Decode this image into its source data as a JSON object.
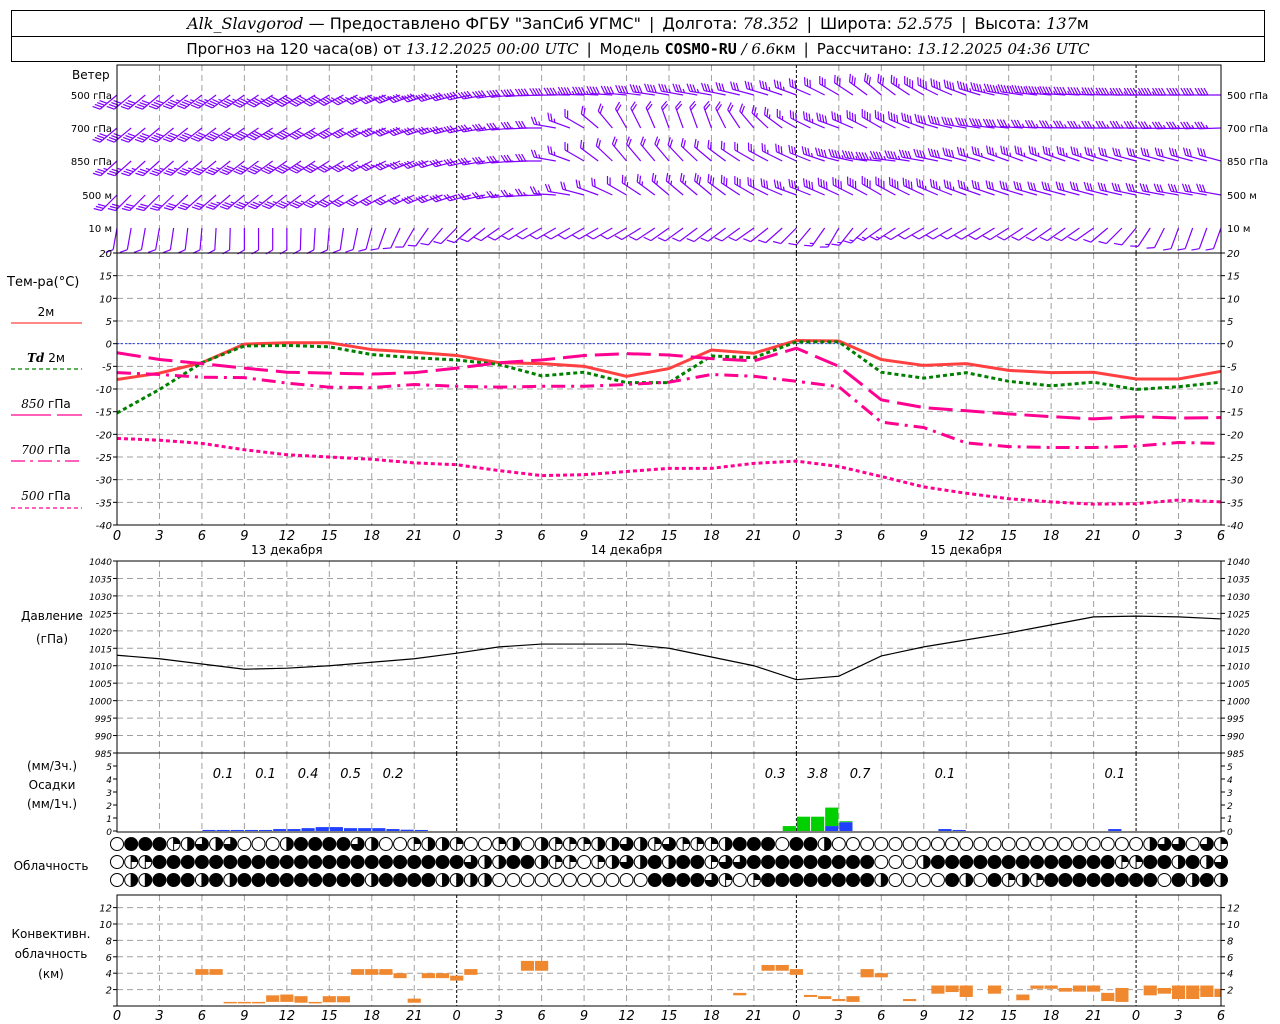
{
  "header": {
    "station": "Alk_Slavgorod",
    "provider": " — Предоставлено ФГБУ \"ЗапСиб УГМС\"",
    "lon_label": "Долгота: ",
    "lon": "78.352",
    "lat_label": "Широта: ",
    "lat": "52.575",
    "alt_label": "Высота: ",
    "alt": "137",
    "alt_unit": "м",
    "forecast_label": "Прогноз на 120 часа(ов) от ",
    "forecast_time": "13.12.2025 00:00 UTC",
    "model_label": "Модель ",
    "model": "COSMO-RU",
    "model_res": " / 6.6",
    "model_res_unit": "км",
    "calc_label": "Рассчитано: ",
    "calc_time": "13.12.2025 04:36 UTC"
  },
  "labels": {
    "wind": "Ветер",
    "temp": "Тем-ра(°C)",
    "t2m": "2м",
    "td_a": "Td",
    "td_b": " 2м",
    "p850_a": "850",
    "p850_b": " гПа",
    "p700_a": "700",
    "p700_b": " гПа",
    "p500_a": "500",
    "p500_b": " гПа",
    "pressure_a": "Давление",
    "pressure_b": "(гПа)",
    "precip_a": "(мм/3ч.)",
    "precip_b": "Осадки",
    "precip_c": "(мм/1ч.)",
    "cloud": "Облачность",
    "conv_a": "Конвективн.",
    "conv_b": "облачность",
    "conv_c": "(км)"
  },
  "colors": {
    "wind": "#8000ff",
    "t2m": "#ff4040",
    "td": "#008000",
    "upper": "#ff0090",
    "zero_line": "#2040ff",
    "precip_rain": "#2040ff",
    "precip_snow": "#00d000",
    "convective": "#f08830",
    "grid": "#a0a0a0"
  },
  "chart_data": {
    "type": "meteogram",
    "time_axis": {
      "hours_range": [
        0,
        78
      ],
      "tick_labels": [
        "0",
        "3",
        "6",
        "9",
        "12",
        "15",
        "18",
        "21",
        "0",
        "3",
        "6",
        "9",
        "12",
        "15",
        "18",
        "21",
        "0",
        "3",
        "6",
        "9",
        "12",
        "15",
        "18",
        "21",
        "0",
        "3",
        "6"
      ],
      "day_labels": [
        {
          "hour": 12,
          "text": "13 декабря"
        },
        {
          "hour": 36,
          "text": "14 декабря"
        },
        {
          "hour": 60,
          "text": "15 декабря"
        }
      ],
      "day_boundaries": [
        0,
        24,
        48,
        72
      ]
    },
    "wind": {
      "levels": [
        {
          "name": "500 гПа",
          "dir": [
            230,
            230,
            232,
            235,
            238,
            240,
            245,
            250,
            255,
            262,
            268,
            272,
            275,
            280,
            280,
            285,
            290,
            300,
            310,
            300,
            290,
            280,
            275,
            272,
            270,
            270,
            270
          ],
          "speed": [
            22,
            22,
            23,
            24,
            25,
            25,
            24,
            23,
            22,
            22,
            22,
            23,
            22,
            20,
            18,
            17,
            18,
            15,
            16,
            20,
            22,
            25,
            25,
            24,
            24,
            22,
            22
          ]
        },
        {
          "name": "700 гПа",
          "dir": [
            230,
            230,
            232,
            235,
            238,
            240,
            245,
            250,
            255,
            262,
            270,
            300,
            330,
            340,
            340,
            320,
            300,
            290,
            300,
            290,
            280,
            275,
            272,
            270,
            270,
            268,
            268
          ],
          "speed": [
            20,
            20,
            21,
            22,
            22,
            22,
            21,
            20,
            19,
            18,
            16,
            12,
            10,
            10,
            11,
            12,
            14,
            20,
            22,
            22,
            20,
            20,
            19,
            19,
            18,
            18,
            18
          ]
        },
        {
          "name": "850 гПа",
          "dir": [
            228,
            228,
            230,
            232,
            235,
            238,
            242,
            248,
            255,
            262,
            270,
            300,
            320,
            320,
            310,
            300,
            295,
            285,
            275,
            280,
            285,
            290,
            290,
            288,
            285,
            285,
            285
          ],
          "speed": [
            18,
            18,
            19,
            20,
            20,
            20,
            19,
            18,
            17,
            16,
            15,
            12,
            10,
            10,
            11,
            12,
            15,
            22,
            24,
            22,
            20,
            18,
            18,
            18,
            17,
            17,
            17
          ]
        },
        {
          "name": "500 м",
          "dir": [
            225,
            225,
            228,
            230,
            232,
            235,
            240,
            245,
            252,
            260,
            268,
            285,
            300,
            310,
            310,
            300,
            290,
            295,
            300,
            295,
            290,
            288,
            285,
            285,
            282,
            280,
            280
          ],
          "speed": [
            16,
            16,
            17,
            18,
            18,
            18,
            17,
            16,
            15,
            14,
            13,
            12,
            12,
            14,
            15,
            16,
            18,
            22,
            22,
            20,
            18,
            17,
            17,
            16,
            16,
            15,
            15
          ]
        },
        {
          "name": "10  м",
          "dir": [
            190,
            190,
            185,
            180,
            180,
            185,
            195,
            210,
            225,
            235,
            240,
            240,
            240,
            235,
            232,
            235,
            225,
            210,
            235,
            240,
            240,
            238,
            235,
            235,
            220,
            200,
            200
          ],
          "speed": [
            6,
            6,
            7,
            7,
            7,
            7,
            7,
            7,
            7,
            7,
            7,
            7,
            7,
            7,
            6,
            6,
            7,
            8,
            8,
            7,
            7,
            7,
            7,
            6,
            6,
            6,
            6
          ]
        }
      ]
    },
    "temperature": {
      "ylim": [
        -40,
        20
      ],
      "ticks": [
        "20",
        "15",
        "10",
        "5",
        "0",
        "-5",
        "-10",
        "-15",
        "-20",
        "-25",
        "-30",
        "-35",
        "-40"
      ],
      "series": [
        {
          "name": "2м",
          "values": [
            -7.9,
            -6.5,
            -4.2,
            -0.1,
            0.2,
            0.2,
            -1.3,
            -1.9,
            -2.6,
            -4.2,
            -4.4,
            -5.0,
            -7.2,
            -5.5,
            -1.4,
            -2.1,
            0.7,
            0.6,
            -3.5,
            -4.8,
            -4.4,
            -5.9,
            -6.4,
            -6.3,
            -7.8,
            -7.8,
            -6.1
          ]
        },
        {
          "name": "Td 2м",
          "values": [
            -15.3,
            -10.1,
            -4.2,
            -0.5,
            -0.4,
            -0.7,
            -2.4,
            -3.1,
            -3.6,
            -4.6,
            -7.1,
            -6.3,
            -8.6,
            -8.6,
            -2.7,
            -3.1,
            0.4,
            0.4,
            -6.3,
            -7.6,
            -6.4,
            -8.3,
            -9.3,
            -8.5,
            -10.1,
            -9.5,
            -8.5
          ]
        },
        {
          "name": "850 гПа",
          "values": [
            -2.0,
            -3.5,
            -4.4,
            -5.4,
            -6.3,
            -6.5,
            -6.7,
            -6.4,
            -5.4,
            -4.2,
            -3.6,
            -2.6,
            -2.2,
            -2.5,
            -3.3,
            -3.8,
            -1.0,
            -5.0,
            -12.4,
            -14.1,
            -14.8,
            -15.5,
            -16.1,
            -16.6,
            -16.1,
            -16.4,
            -16.3
          ]
        },
        {
          "name": "700 гПа",
          "values": [
            -6.4,
            -6.8,
            -7.4,
            -7.5,
            -8.7,
            -9.6,
            -9.7,
            -9.0,
            -9.4,
            -9.6,
            -9.4,
            -9.4,
            -9.0,
            -8.5,
            -6.8,
            -7.2,
            -8.3,
            -9.5,
            -17.3,
            -18.5,
            -21.9,
            -22.7,
            -22.9,
            -22.9,
            -22.6,
            -21.8,
            -22.0
          ]
        },
        {
          "name": "500 гПа",
          "values": [
            -20.9,
            -21.3,
            -22.0,
            -23.4,
            -24.5,
            -25.0,
            -25.5,
            -26.3,
            -26.7,
            -28.0,
            -29.1,
            -28.9,
            -28.2,
            -27.5,
            -27.5,
            -26.4,
            -25.9,
            -27.1,
            -29.3,
            -31.6,
            -33.0,
            -34.2,
            -34.9,
            -35.4,
            -35.3,
            -34.5,
            -34.9
          ]
        }
      ]
    },
    "pressure": {
      "ylim": [
        985,
        1040
      ],
      "ticks": [
        "1040",
        "1035",
        "1030",
        "1025",
        "1020",
        "1015",
        "1010",
        "1005",
        "1000",
        "995",
        "990",
        "985"
      ],
      "values": [
        1013,
        1012,
        1010.5,
        1009,
        1009.3,
        1010,
        1011,
        1012,
        1013.6,
        1015.4,
        1016.2,
        1016.2,
        1016.2,
        1015,
        1012.5,
        1010,
        1006,
        1007,
        1012.8,
        1015.4,
        1017.4,
        1019.4,
        1021.7,
        1024,
        1024.2,
        1024,
        1023.4
      ]
    },
    "precipitation": {
      "ylim": [
        0,
        5
      ],
      "ticks": [
        "5",
        "4",
        "3",
        "2",
        "1",
        "0"
      ],
      "hourly_rain": [
        [
          6,
          0.08
        ],
        [
          7,
          0.08
        ],
        [
          8,
          0.08
        ],
        [
          9,
          0.08
        ],
        [
          10,
          0.08
        ],
        [
          11,
          0.15
        ],
        [
          12,
          0.15
        ],
        [
          13,
          0.22
        ],
        [
          14,
          0.3
        ],
        [
          15,
          0.3
        ],
        [
          16,
          0.22
        ],
        [
          17,
          0.22
        ],
        [
          18,
          0.22
        ],
        [
          19,
          0.15
        ],
        [
          20,
          0.1
        ],
        [
          21,
          0.08
        ],
        [
          50,
          0.38
        ],
        [
          51,
          0.68
        ],
        [
          58,
          0.15
        ],
        [
          59,
          0.08
        ],
        [
          70,
          0.15
        ]
      ],
      "hourly_snow": [
        [
          47,
          0.38
        ],
        [
          48,
          1.1
        ],
        [
          49,
          1.1
        ],
        [
          50,
          1.42
        ],
        [
          51,
          0.07
        ]
      ],
      "totals_3h": [
        {
          "hour": 7.5,
          "text": "0.1"
        },
        {
          "hour": 10.5,
          "text": "0.1"
        },
        {
          "hour": 13.5,
          "text": "0.4"
        },
        {
          "hour": 16.5,
          "text": "0.5"
        },
        {
          "hour": 19.5,
          "text": "0.2"
        },
        {
          "hour": 46.5,
          "text": "0.3"
        },
        {
          "hour": 49.5,
          "text": "3.8"
        },
        {
          "hour": 52.5,
          "text": "0.7"
        },
        {
          "hour": 58.5,
          "text": "0.1"
        },
        {
          "hour": 70.5,
          "text": "0.1"
        }
      ]
    },
    "cloudiness_quarters": [
      [
        0,
        4,
        4,
        4,
        1,
        2,
        3,
        2,
        3,
        0,
        0,
        0,
        2,
        4,
        4,
        4,
        4,
        3,
        2,
        0,
        0,
        1,
        2,
        2,
        1,
        0,
        0,
        1,
        2,
        0,
        2,
        1,
        1,
        1,
        2,
        2,
        3,
        2,
        1,
        3,
        1,
        1,
        1,
        2,
        4,
        4,
        4,
        0,
        4,
        4,
        2,
        0,
        0,
        0,
        0,
        0,
        0,
        0,
        0,
        0,
        0,
        0,
        0,
        0,
        0,
        0,
        0,
        0,
        0,
        0,
        0,
        0,
        0,
        2,
        3,
        3,
        0,
        3,
        1
      ],
      [
        0,
        1,
        1,
        4,
        4,
        4,
        4,
        4,
        4,
        4,
        4,
        4,
        4,
        4,
        4,
        4,
        4,
        4,
        4,
        4,
        4,
        4,
        4,
        4,
        4,
        3,
        2,
        2,
        4,
        4,
        2,
        1,
        1,
        0,
        1,
        2,
        3,
        2,
        4,
        2,
        4,
        4,
        1,
        3,
        3,
        4,
        4,
        4,
        4,
        4,
        4,
        4,
        4,
        4,
        0,
        0,
        0,
        2,
        4,
        4,
        4,
        4,
        4,
        4,
        4,
        4,
        4,
        4,
        4,
        4,
        4,
        1,
        1,
        4,
        4,
        2,
        4,
        2,
        3
      ],
      [
        0,
        2,
        2,
        4,
        4,
        4,
        2,
        4,
        2,
        4,
        4,
        4,
        4,
        4,
        4,
        4,
        4,
        4,
        2,
        4,
        4,
        4,
        4,
        2,
        2,
        2,
        2,
        0,
        0,
        0,
        0,
        0,
        0,
        0,
        0,
        0,
        0,
        0,
        4,
        4,
        4,
        4,
        3,
        1,
        0,
        1,
        4,
        4,
        4,
        4,
        4,
        4,
        4,
        4,
        2,
        0,
        0,
        0,
        0,
        4,
        2,
        0,
        4,
        1,
        2,
        1,
        4,
        4,
        4,
        4,
        4,
        4,
        4,
        4,
        0,
        4,
        2,
        4,
        2
      ]
    ],
    "convective": {
      "ylim": [
        0,
        13
      ],
      "ticks": [
        "12",
        "10",
        "8",
        "6",
        "4",
        "2",
        "0"
      ],
      "layers": [
        [
          6,
          3.8,
          4.5
        ],
        [
          7,
          3.8,
          4.5
        ],
        [
          8,
          0.4,
          0.5
        ],
        [
          9,
          0.4,
          0.5
        ],
        [
          10,
          0.4,
          0.5
        ],
        [
          11,
          0.5,
          1.3
        ],
        [
          12,
          0.5,
          1.4
        ],
        [
          13,
          0.4,
          1.2
        ],
        [
          14,
          0.4,
          0.5
        ],
        [
          15,
          0.45,
          1.2
        ],
        [
          16,
          0.45,
          1.2
        ],
        [
          17,
          3.8,
          4.5
        ],
        [
          18,
          3.8,
          4.5
        ],
        [
          19,
          3.8,
          4.5
        ],
        [
          20,
          3.4,
          4.0
        ],
        [
          21,
          0.4,
          0.9
        ],
        [
          22,
          3.4,
          4.0
        ],
        [
          23,
          3.4,
          4.0
        ],
        [
          24,
          3.1,
          3.7
        ],
        [
          25,
          3.8,
          4.5
        ],
        [
          29,
          4.3,
          5.5
        ],
        [
          30,
          4.3,
          5.5
        ],
        [
          44,
          1.3,
          1.6
        ],
        [
          46,
          4.3,
          5.0
        ],
        [
          47,
          4.3,
          5.0
        ],
        [
          48,
          3.8,
          4.5
        ],
        [
          49,
          1.1,
          1.35
        ],
        [
          50,
          0.85,
          1.2
        ],
        [
          51,
          0.6,
          0.85
        ],
        [
          52,
          0.5,
          1.2
        ],
        [
          53,
          3.5,
          4.5
        ],
        [
          54,
          3.5,
          4.0
        ],
        [
          56,
          0.6,
          0.85
        ],
        [
          58,
          1.5,
          2.5
        ],
        [
          59,
          1.7,
          2.5
        ],
        [
          60,
          1.1,
          2.5
        ],
        [
          62,
          1.5,
          2.5
        ],
        [
          64,
          0.7,
          1.4
        ],
        [
          65,
          2.1,
          2.5
        ],
        [
          66,
          2.1,
          2.5
        ],
        [
          67,
          1.75,
          2.2
        ],
        [
          68,
          1.75,
          2.5
        ],
        [
          69,
          1.75,
          2.5
        ],
        [
          70,
          0.6,
          1.6
        ],
        [
          71,
          0.5,
          2.2
        ],
        [
          73,
          1.3,
          2.5
        ],
        [
          74,
          1.5,
          2.2
        ],
        [
          75,
          0.85,
          2.5
        ],
        [
          76,
          0.85,
          2.5
        ],
        [
          77,
          1.1,
          2.5
        ],
        [
          78,
          1.1,
          2.1
        ]
      ]
    }
  }
}
